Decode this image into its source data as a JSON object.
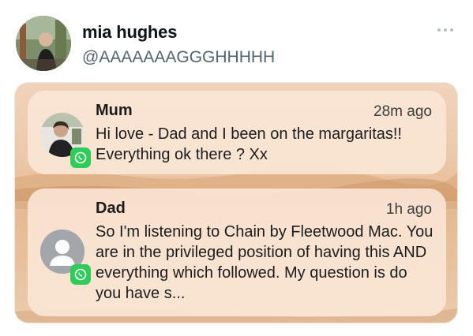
{
  "tweet": {
    "author_name": "mia hughes",
    "author_handle": "@AAAAAAAGGGHHHHH"
  },
  "notifications": [
    {
      "sender": "Mum",
      "time": "28m ago",
      "message": "Hi love - Dad and I been on the margaritas!! Everything ok there ? Xx",
      "app_icon": "whatsapp-icon"
    },
    {
      "sender": "Dad",
      "time": "1h ago",
      "message": "So I'm listening to Chain by Fleetwood Mac. You are in the privileged position of having this AND everything which followed. My question is do you have s...",
      "app_icon": "whatsapp-icon"
    }
  ],
  "colors": {
    "whatsapp_green": "#2ecc58",
    "handle_gray": "#536471",
    "notification_bg": "#fae7d7"
  }
}
